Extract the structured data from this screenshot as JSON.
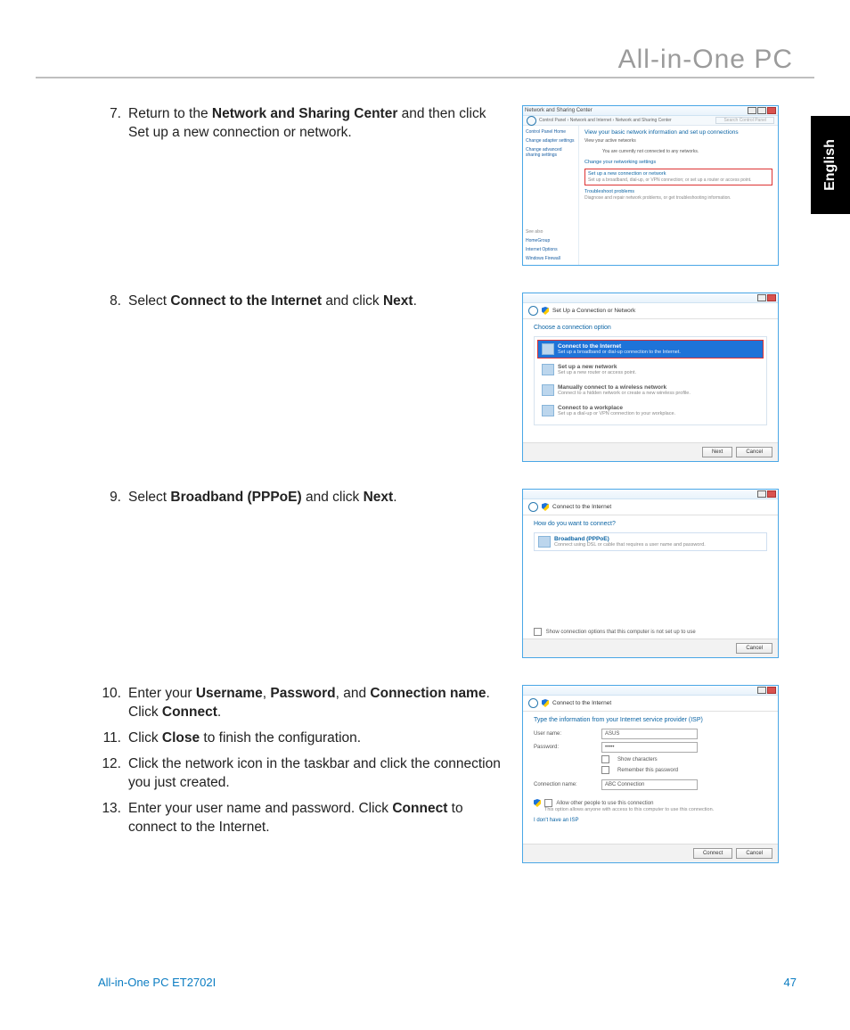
{
  "header": {
    "title": "All-in-One PC"
  },
  "lang_tab": "English",
  "steps": {
    "s7": {
      "num": "7.",
      "text": [
        "Return to the ",
        "Network and Sharing Center",
        " and then click Set up a new connection or network."
      ]
    },
    "s8": {
      "num": "8.",
      "text": [
        "Select ",
        "Connect to the Internet",
        " and click ",
        "Next",
        "."
      ]
    },
    "s9": {
      "num": "9.",
      "text": [
        "Select ",
        "Broadband (PPPoE)",
        " and click ",
        "Next",
        "."
      ]
    },
    "s10": {
      "num": "10.",
      "text": [
        "Enter your ",
        "Username",
        ", ",
        "Password",
        ", and ",
        "Connection name",
        ". Click ",
        "Connect",
        "."
      ]
    },
    "s11": {
      "num": "11.",
      "text": [
        "Click ",
        "Close",
        " to finish the configuration."
      ]
    },
    "s12": {
      "num": "12.",
      "text": [
        "Click the network icon in the taskbar and click the connection you just created."
      ]
    },
    "s13": {
      "num": "13.",
      "text": [
        "Enter your user name and password. Click ",
        "Connect",
        " to connect to the Internet."
      ]
    }
  },
  "shot1": {
    "win_title": "Network and Sharing Center",
    "breadcrumb": "Control Panel › Network and Internet › Network and Sharing Center",
    "search_placeholder": "Search Control Panel",
    "left": {
      "home": "Control Panel Home",
      "l1": "Change adapter settings",
      "l2": "Change advanced sharing settings",
      "see_also": "See also",
      "sa1": "HomeGroup",
      "sa2": "Internet Options",
      "sa3": "Windows Firewall"
    },
    "main": {
      "title": "View your basic network information and set up connections",
      "active_label": "View your active networks",
      "active_text": "You are currently not connected to any networks.",
      "change_label": "Change your networking settings",
      "setup_title": "Set up a new connection or network",
      "setup_sub": "Set up a broadband, dial-up, or VPN connection; or set up a router or access point.",
      "trouble_title": "Troubleshoot problems",
      "trouble_sub": "Diagnose and repair network problems, or get troubleshooting information."
    }
  },
  "shot2": {
    "head": "Set Up a Connection or Network",
    "subtitle": "Choose a connection option",
    "opts": [
      {
        "t": "Connect to the Internet",
        "s": "Set up a broadband or dial-up connection to the Internet."
      },
      {
        "t": "Set up a new network",
        "s": "Set up a new router or access point."
      },
      {
        "t": "Manually connect to a wireless network",
        "s": "Connect to a hidden network or create a new wireless profile."
      },
      {
        "t": "Connect to a workplace",
        "s": "Set up a dial-up or VPN connection to your workplace."
      }
    ],
    "next": "Next",
    "cancel": "Cancel"
  },
  "shot3": {
    "head": "Connect to the Internet",
    "subtitle": "How do you want to connect?",
    "opt_t": "Broadband (PPPoE)",
    "opt_s": "Connect using DSL or cable that requires a user name and password.",
    "show_opts": "Show connection options that this computer is not set up to use",
    "cancel": "Cancel"
  },
  "shot4": {
    "head": "Connect to the Internet",
    "subtitle": "Type the information from your Internet service provider (ISP)",
    "f_user_l": "User name:",
    "f_user_v": "ASUS",
    "f_pass_l": "Password:",
    "f_pass_v": "•••••",
    "f_show": "Show characters",
    "f_remember": "Remember this password",
    "f_conn_l": "Connection name:",
    "f_conn_v": "ABC Connection",
    "allow": "Allow other people to use this connection",
    "allow_sub": "This option allows anyone with access to this computer to use this connection.",
    "no_isp": "I don't have an ISP",
    "connect": "Connect",
    "cancel": "Cancel"
  },
  "footer": {
    "model": "All-in-One PC ET2702I",
    "page": "47"
  }
}
